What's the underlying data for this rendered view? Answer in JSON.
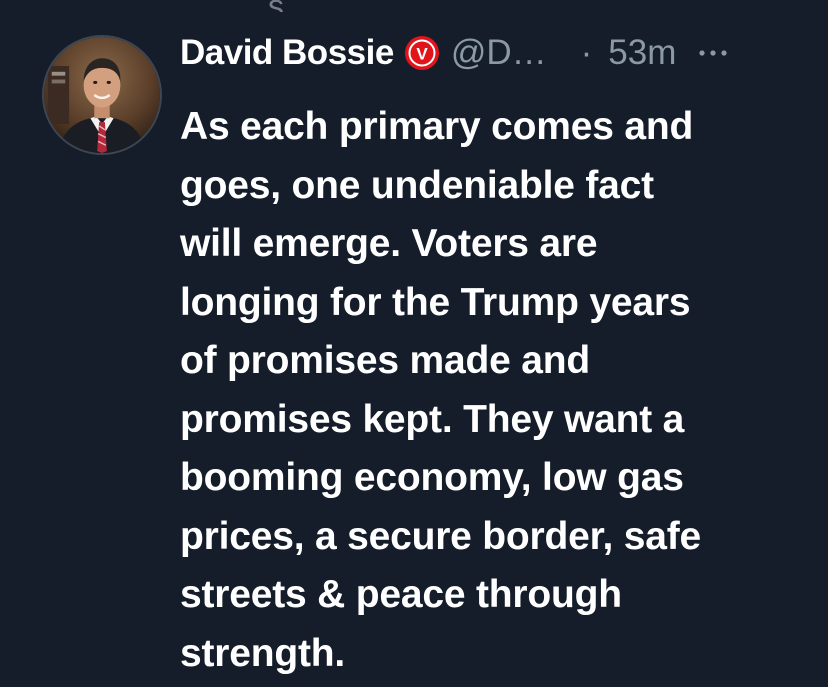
{
  "top_fragment": "s, . . . . ,",
  "tweet": {
    "author_name": "David Bossie",
    "verified_badge_icon": "verified-badge-icon",
    "verified_badge_letter": "V",
    "badge_color": "#e0151b",
    "handle": "@D…",
    "separator": "·",
    "time": "53m",
    "more_icon": "more-options-icon",
    "text": "As each primary comes and\ngoes, one undeniable fact\nwill emerge. Voters are\nlonging for the Trump years\nof promises made and\npromises kept. They want a\nbooming economy, low gas\nprices, a secure border, safe\nstreets & peace through\nstrength."
  },
  "colors": {
    "background": "#151d2a",
    "primary_text": "#ffffff",
    "secondary_text": "#8b98a5"
  }
}
